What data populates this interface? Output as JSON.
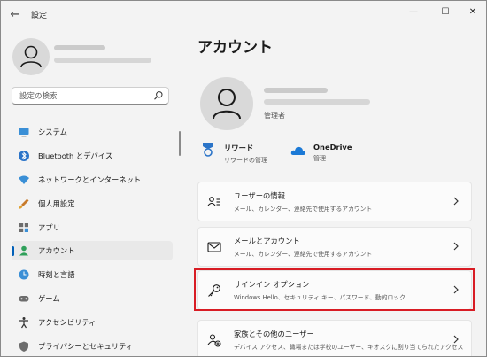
{
  "titlebar": {
    "back_glyph": "←",
    "title": "設定",
    "minimize_glyph": "—",
    "maximize_glyph": "☐",
    "close_glyph": "✕"
  },
  "search": {
    "placeholder": "設定の検索"
  },
  "sidebar": {
    "items": [
      {
        "label": "システム",
        "icon": "system-icon"
      },
      {
        "label": "Bluetooth とデバイス",
        "icon": "bluetooth-icon"
      },
      {
        "label": "ネットワークとインターネット",
        "icon": "network-icon"
      },
      {
        "label": "個人用設定",
        "icon": "personalization-icon"
      },
      {
        "label": "アプリ",
        "icon": "apps-icon"
      },
      {
        "label": "アカウント",
        "icon": "account-icon",
        "active": true
      },
      {
        "label": "時刻と言語",
        "icon": "time-language-icon"
      },
      {
        "label": "ゲーム",
        "icon": "gaming-icon"
      },
      {
        "label": "アクセシビリティ",
        "icon": "accessibility-icon"
      },
      {
        "label": "プライバシーとセキュリティ",
        "icon": "privacy-icon"
      }
    ]
  },
  "main": {
    "title": "アカウント",
    "role": "管理者",
    "quick": [
      {
        "title": "リワード",
        "sub": "リワードの管理",
        "icon": "rewards-icon"
      },
      {
        "title": "OneDrive",
        "sub": "管理",
        "icon": "onedrive-icon"
      }
    ],
    "cards": [
      {
        "title": "ユーザーの情報",
        "sub": "メール、カレンダー、連絡先で使用するアカウント",
        "icon": "user-info-icon"
      },
      {
        "title": "メールとアカウント",
        "sub": "メール、カレンダー、連絡先で使用するアカウント",
        "icon": "mail-icon"
      },
      {
        "title": "サインイン オプション",
        "sub": "Windows Hello、セキュリティ キー、パスワード、動的ロック",
        "icon": "key-icon"
      },
      {
        "title": "家族とその他のユーザー",
        "sub": "デバイス アクセス、職場または学校のユーザー、キオスクに割り当てられたアクセス",
        "icon": "family-icon"
      }
    ]
  },
  "colors": {
    "accent": "#005fb8",
    "highlight": "#d81c24"
  }
}
